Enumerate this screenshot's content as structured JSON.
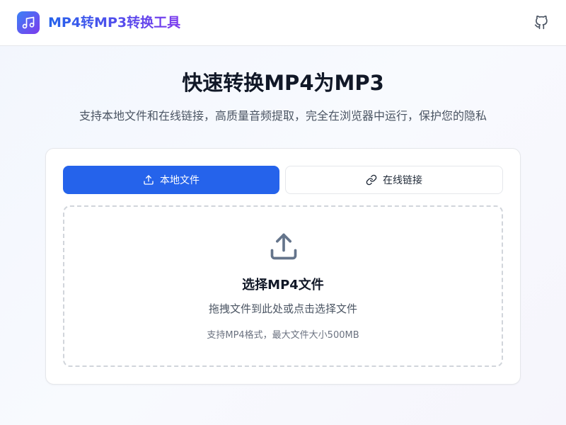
{
  "header": {
    "app_title": "MP4转MP3转换工具",
    "logo_icon": "music-note-icon",
    "github_icon": "github-icon"
  },
  "hero": {
    "title": "快速转换MP4为MP3",
    "subtitle": "支持本地文件和在线链接，高质量音频提取，完全在浏览器中运行，保护您的隐私"
  },
  "tabs": [
    {
      "label": "本地文件",
      "icon": "upload-icon",
      "active": true
    },
    {
      "label": "在线链接",
      "icon": "link-icon",
      "active": false
    }
  ],
  "dropzone": {
    "icon": "upload-icon",
    "title": "选择MP4文件",
    "subtitle": "拖拽文件到此处或点击选择文件",
    "hint": "支持MP4格式，最大文件大小500MB"
  },
  "colors": {
    "primary": "#2563eb",
    "gradient_start": "#3b82f6",
    "gradient_end": "#7c3aed"
  }
}
